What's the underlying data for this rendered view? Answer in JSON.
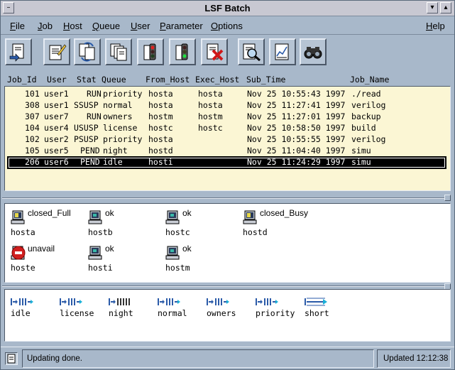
{
  "window": {
    "title": "LSF Batch"
  },
  "menubar": {
    "items": [
      {
        "label": "File"
      },
      {
        "label": "Job"
      },
      {
        "label": "Host"
      },
      {
        "label": "Queue"
      },
      {
        "label": "User"
      },
      {
        "label": "Parameter"
      },
      {
        "label": "Options"
      },
      {
        "label": "Help"
      }
    ]
  },
  "toolbar": {
    "buttons": [
      {
        "icon": "submit-job-icon"
      },
      {
        "icon": "edit-job-icon"
      },
      {
        "icon": "switch-job-icon"
      },
      {
        "icon": "copy-job-icon"
      },
      {
        "icon": "suspend-job-icon"
      },
      {
        "icon": "resume-job-icon"
      },
      {
        "icon": "kill-job-icon"
      },
      {
        "icon": "job-detail-icon"
      },
      {
        "icon": "job-history-icon"
      },
      {
        "icon": "find-icon"
      }
    ]
  },
  "jobs": {
    "columns": [
      "Job_Id",
      "User",
      "Stat",
      "Queue",
      "From_Host",
      "Exec_Host",
      "Sub_Time",
      "Job_Name"
    ],
    "rows": [
      {
        "id": "101",
        "user": "user1",
        "stat": "RUN",
        "queue": "priority",
        "from": "hosta",
        "exec": "hosta",
        "time": "Nov 25 10:55:43 1997",
        "name": "./read"
      },
      {
        "id": "308",
        "user": "user1",
        "stat": "SSUSP",
        "queue": "normal",
        "from": "hosta",
        "exec": "hosta",
        "time": "Nov 25 11:27:41 1997",
        "name": "verilog"
      },
      {
        "id": "307",
        "user": "user7",
        "stat": "RUN",
        "queue": "owners",
        "from": "hostm",
        "exec": "hostm",
        "time": "Nov 25 11:27:01 1997",
        "name": "backup"
      },
      {
        "id": "104",
        "user": "user4",
        "stat": "USUSP",
        "queue": "license",
        "from": "hostc",
        "exec": "hostc",
        "time": "Nov 25 10:58:50 1997",
        "name": "build"
      },
      {
        "id": "102",
        "user": "user2",
        "stat": "PSUSP",
        "queue": "priority",
        "from": "hosta",
        "exec": "",
        "time": "Nov 25 10:55:55 1997",
        "name": "verilog"
      },
      {
        "id": "105",
        "user": "user5",
        "stat": "PEND",
        "queue": "night",
        "from": "hostd",
        "exec": "",
        "time": "Nov 25 11:04:40 1997",
        "name": "simu"
      },
      {
        "id": "206",
        "user": "user6",
        "stat": "PEND",
        "queue": "idle",
        "from": "hosti",
        "exec": "",
        "time": "Nov 25 11:24:29 1997",
        "name": "simu"
      }
    ]
  },
  "hosts": [
    {
      "name": "hosta",
      "status": "closed_Full",
      "icon": "host-closed-icon"
    },
    {
      "name": "hostb",
      "status": "ok",
      "icon": "host-ok-icon"
    },
    {
      "name": "hostc",
      "status": "ok",
      "icon": "host-ok-icon"
    },
    {
      "name": "hostd",
      "status": "closed_Busy",
      "icon": "host-closed-icon"
    },
    {
      "name": "hoste",
      "status": "unavail",
      "icon": "host-unavail-icon"
    },
    {
      "name": "hosti",
      "status": "ok",
      "icon": "host-ok-icon"
    },
    {
      "name": "hostm",
      "status": "ok",
      "icon": "host-ok-icon"
    }
  ],
  "queues": [
    {
      "name": "idle"
    },
    {
      "name": "license"
    },
    {
      "name": "night"
    },
    {
      "name": "normal"
    },
    {
      "name": "owners"
    },
    {
      "name": "priority"
    },
    {
      "name": "short"
    }
  ],
  "status": {
    "message": "Updating done.",
    "updated": "Updated 12:12:38"
  },
  "colors": {
    "job_pane_bg": "#fbf6d4",
    "window_bg": "#a8b8ca",
    "unavail": "#d02020"
  }
}
